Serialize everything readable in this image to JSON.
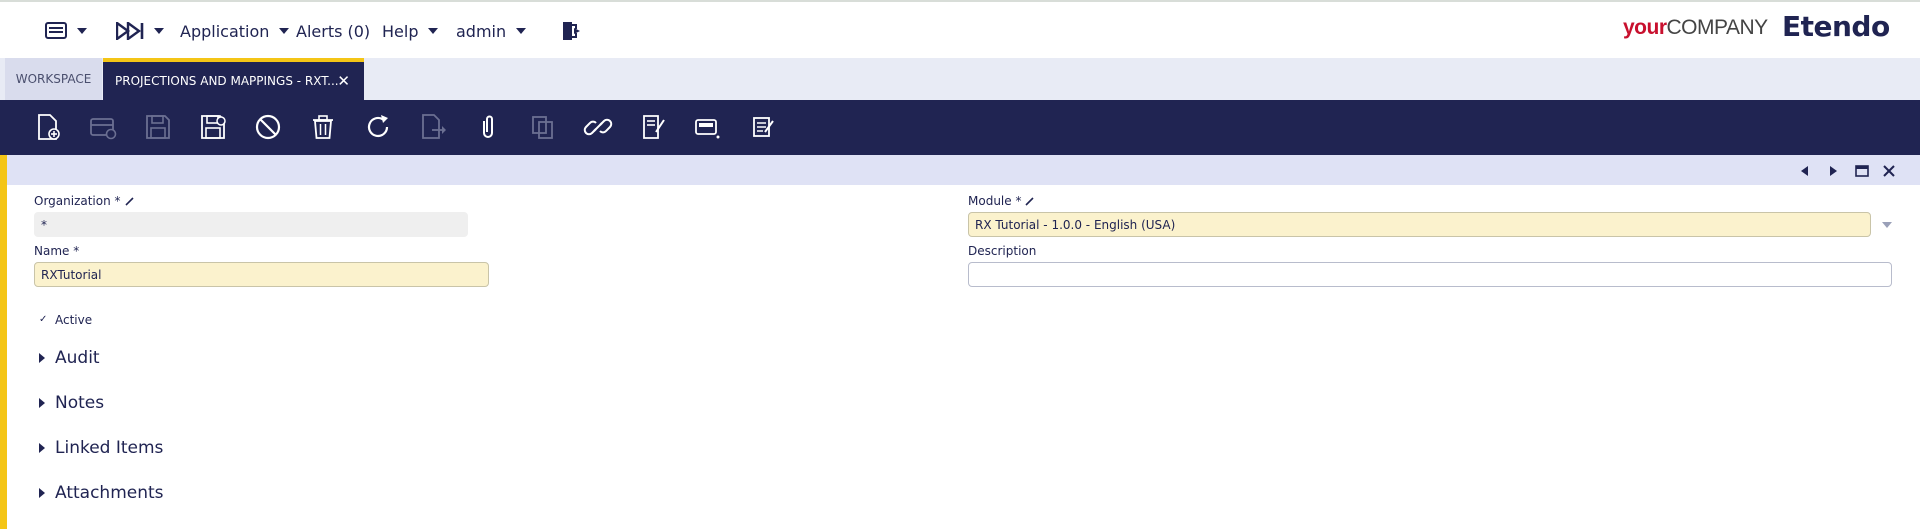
{
  "topbar": {
    "menu": [
      {
        "label": "Application"
      },
      {
        "label": "Alerts (0)"
      },
      {
        "label": "Help"
      },
      {
        "label": "admin"
      }
    ],
    "brand_your": "your",
    "brand_company": "COMPANY",
    "brand_name": "Etendo"
  },
  "tabs": {
    "workspace": "Workspace",
    "active": "Projections and Mappings - RXT...",
    "close_glyph": "✕"
  },
  "toolbar": {
    "icons": [
      "new-document-icon",
      "new-row-icon",
      "save-icon",
      "save-and-close-icon",
      "undo-icon",
      "delete-icon",
      "refresh-icon",
      "export-icon",
      "attachment-icon",
      "clone-icon",
      "link-icon",
      "print-icon",
      "grid-view-icon",
      "notes-icon"
    ]
  },
  "form": {
    "organization_label": "Organization *",
    "organization_value": "*",
    "module_label": "Module *",
    "module_value": "RX Tutorial - 1.0.0 - English (USA)",
    "name_label": "Name *",
    "name_value": "RXTutorial",
    "description_label": "Description",
    "description_value": "",
    "active_label": "Active",
    "active_checked": true
  },
  "sections": [
    {
      "label": "Audit"
    },
    {
      "label": "Notes"
    },
    {
      "label": "Linked Items"
    },
    {
      "label": "Attachments"
    }
  ],
  "colors": {
    "primary": "#202452",
    "accent": "#f4c516",
    "required_field": "#fbf2cd",
    "status_bar": "#dfe2f5"
  }
}
